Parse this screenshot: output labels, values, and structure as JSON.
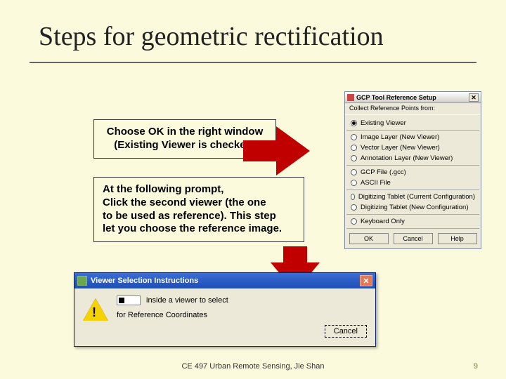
{
  "slide": {
    "title": "Steps for geometric rectification",
    "footer_text": "CE 497 Urban Remote Sensing, Jie Shan",
    "page": "9"
  },
  "notes": {
    "box1_l1": "Choose OK in the right window",
    "box1_l2": "(Existing Viewer is checked)",
    "box2_l1": "At the following prompt,",
    "box2_l2": "Click the second viewer (the one",
    "box2_l3": "to be used as reference). This step",
    "box2_l4": "let you choose the reference image."
  },
  "gcp": {
    "title": "GCP Tool Reference Setup",
    "subtitle": "Collect Reference Points from:",
    "options": [
      "Existing Viewer",
      "Image Layer (New Viewer)",
      "Vector Layer (New Viewer)",
      "Annotation Layer (New Viewer)",
      "GCP File (.gcc)",
      "ASCII File",
      "Digitizing Tablet (Current Configuration)",
      "Digitizing Tablet (New Configuration)",
      "Keyboard Only"
    ],
    "ok": "OK",
    "cancel": "Cancel",
    "help": "Help"
  },
  "vs": {
    "title": "Viewer Selection Instructions",
    "line1": "inside a viewer to select",
    "line2": "for Reference Coordinates",
    "cancel": "Cancel"
  }
}
